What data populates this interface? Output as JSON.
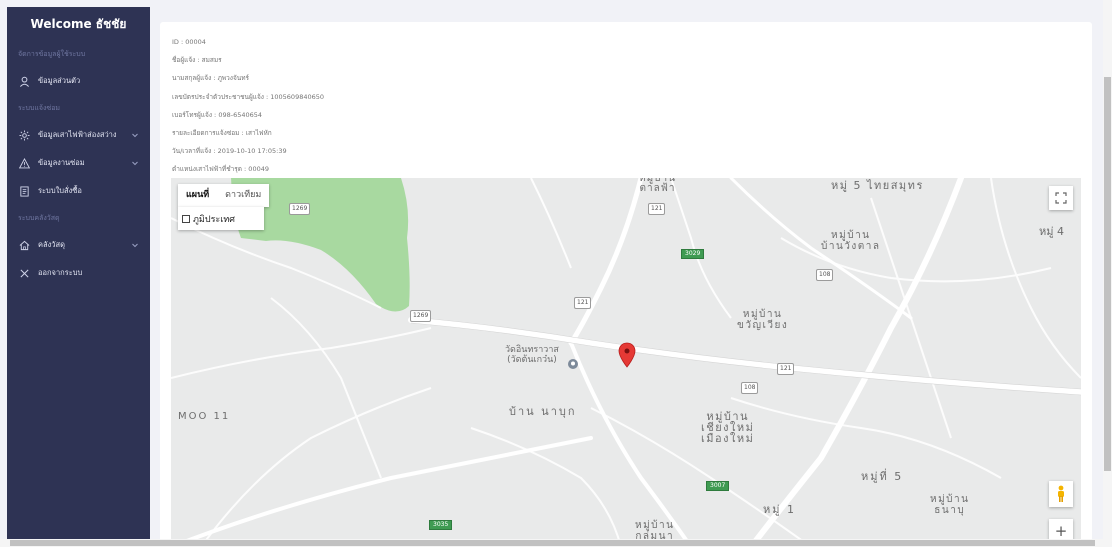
{
  "sidebar": {
    "title": "Welcome ธัชชัย",
    "sections": {
      "user": "จัดการข้อมูลผู้ใช้ระบบ",
      "repair": "ระบบแจ้งซ่อม",
      "material": "ระบบคลังวัสดุ"
    },
    "items": [
      {
        "label": "ข้อมูลส่วนตัว",
        "icon": "user-icon"
      },
      {
        "label": "ข้อมูลเสาไฟฟ้าส่องสว่าง",
        "icon": "sun-icon"
      },
      {
        "label": "ข้อมูลงานซ่อม",
        "icon": "warning-icon"
      },
      {
        "label": "ระบบใบสั่งซื้อ",
        "icon": "document-icon"
      },
      {
        "label": "คลังวัสดุ",
        "icon": "home-icon"
      },
      {
        "label": "ออกจากระบบ",
        "icon": "close-icon"
      }
    ]
  },
  "details": {
    "id": "ID : 00004",
    "reporter_name": "ชื่อผู้แจ้ง : สมสมร",
    "reporter_surname": "นามสกุลผู้แจ้ง : ภูพวงจันทร์",
    "citizen_id": "เลขบัตรประจำตัวประชาชนผู้แจ้ง : 1005609840650",
    "phone": "เบอร์โทรผู้แจ้ง : 098-6540654",
    "repair_detail": "รายละเอียดการแจ้งซ่อม : เสาไฟหัก",
    "datetime": "วัน/เวลาที่แจ้ง : 2019-10-10 17:05:39",
    "pole_position": "ตำแหน่งเสาไฟฟ้าที่ชำรุด : 00049"
  },
  "map": {
    "type_map": "แผนที่",
    "type_satellite": "ดาวเทียม",
    "terrain": "ภูมิประเทศ",
    "zoom_in": "+",
    "labels": {
      "l1": "หมู่บ้าน\nตาลฟ้า",
      "l2": "หมู่ 5 ไทยสมุทร",
      "l3": "หมู่ 4",
      "l4": "หมู่บ้าน\nบ้านวังตาล",
      "l5": "หมู่บ้าน\nขวัญเวียง",
      "l6": "วัดอินทราวาส\n(วัดต้นเกว๋น)",
      "l7": "บ้าน นาบุก",
      "l8": "MOO 11",
      "l9": "หมู่บ้าน\nเชียงใหม่\nเมืองใหม่",
      "l10": "หมู่ที่ 5",
      "l11": "หมู่ 1",
      "l12": "หมู่บ้าน\nธนาบุ",
      "l13": "หมู่บ้าน\nกลุ่มนา"
    },
    "roads": {
      "r1260": "1269",
      "r121a": "121",
      "r3029": "3029",
      "r108a": "108",
      "r121b": "121",
      "r1269": "1269",
      "r121c": "121",
      "r108b": "108",
      "r3007": "3007",
      "r3035": "3035"
    },
    "colors": {
      "park": "#a8d9a0",
      "road": "#ffffff",
      "marker": "#e53935"
    }
  }
}
